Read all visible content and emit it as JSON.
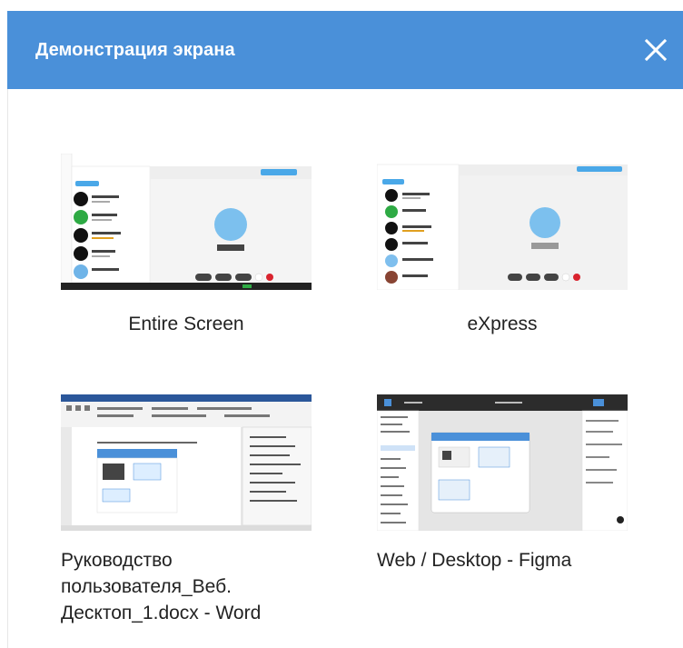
{
  "dialog": {
    "title": "Демонстрация экрана"
  },
  "icons": {
    "close": "close-icon"
  },
  "sources": [
    {
      "label": "Entire Screen",
      "thumbnail": "app-window-thumbnail"
    },
    {
      "label": "eXpress",
      "thumbnail": "app-window-thumbnail"
    },
    {
      "label": "Руководство пользователя_Веб. Десктоп_1.docx - Word",
      "thumbnail": "word-document-thumbnail",
      "label_lines": [
        "Руководство",
        "пользователя_Веб.",
        "Десктоп_1.docx - Word"
      ]
    },
    {
      "label": "Web / Desktop - Figma",
      "thumbnail": "figma-window-thumbnail"
    }
  ],
  "colors": {
    "header": "#4a90d9",
    "accent": "#4aa8e8",
    "figma_dark": "#2c2c2c"
  }
}
